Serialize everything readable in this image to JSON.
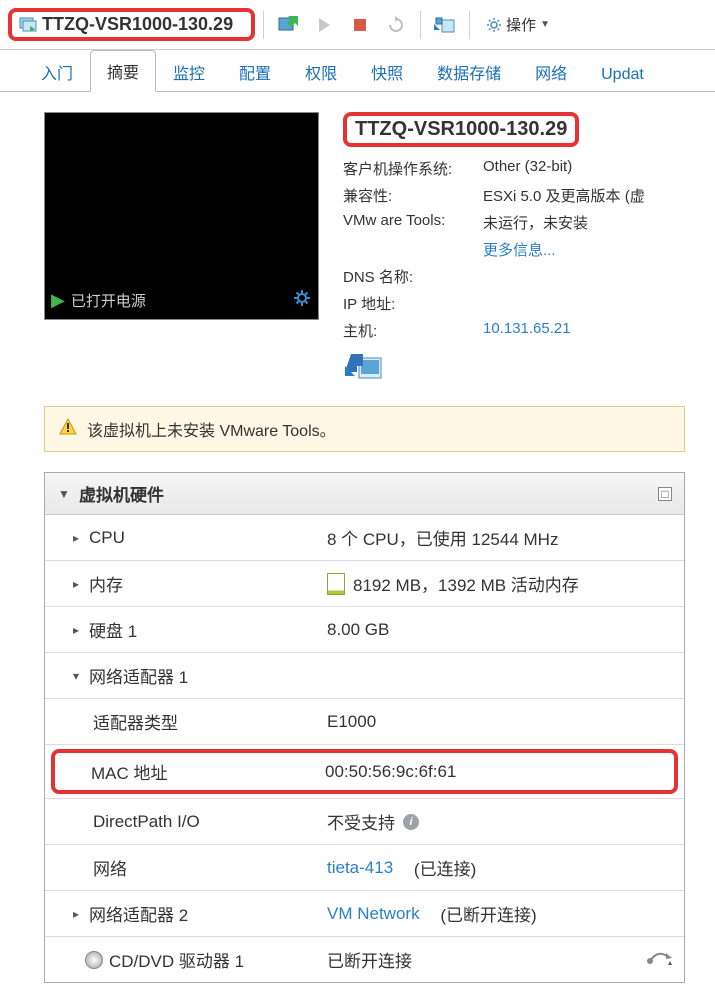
{
  "titlebar": {
    "vm_name": "TTZQ-VSR1000-130.29",
    "actions_label": "操作"
  },
  "tabs": {
    "items": [
      {
        "label": "入门"
      },
      {
        "label": "摘要"
      },
      {
        "label": "监控"
      },
      {
        "label": "配置"
      },
      {
        "label": "权限"
      },
      {
        "label": "快照"
      },
      {
        "label": "数据存储"
      },
      {
        "label": "网络"
      },
      {
        "label": "Updat"
      }
    ],
    "active_index": 1
  },
  "console": {
    "status": "已打开电源"
  },
  "vm": {
    "name": "TTZQ-VSR1000-130.29",
    "guest_os_label": "客户机操作系统:",
    "guest_os": "Other (32-bit)",
    "compat_label": "兼容性:",
    "compat": "ESXi 5.0 及更高版本 (虚",
    "tools_label": "VMw are Tools:",
    "tools": "未运行，未安装",
    "more_info": "更多信息...",
    "dns_label": "DNS 名称:",
    "dns": "",
    "ip_label": "IP 地址:",
    "ip": "",
    "host_label": "主机:",
    "host": "10.131.65.21"
  },
  "warning": {
    "text": "该虚拟机上未安装 VMware Tools。"
  },
  "hardware": {
    "title": "虚拟机硬件",
    "rows": {
      "cpu": {
        "label": "CPU",
        "value": "8 个 CPU，已使用 12544 MHz"
      },
      "memory": {
        "label": "内存",
        "value": "8192 MB，1392 MB 活动内存"
      },
      "disk1": {
        "label": "硬盘 1",
        "value": "8.00 GB"
      },
      "nic1": {
        "label": "网络适配器 1",
        "value": ""
      },
      "adapter_type": {
        "label": "适配器类型",
        "value": "E1000"
      },
      "mac": {
        "label": "MAC 地址",
        "value": "00:50:56:9c:6f:61"
      },
      "directpath": {
        "label": "DirectPath I/O",
        "value": "不受支持"
      },
      "network": {
        "label": "网络",
        "value": "tieta-413",
        "suffix": "(已连接)"
      },
      "nic2": {
        "label": "网络适配器 2",
        "value": "VM Network",
        "suffix": "(已断开连接)"
      },
      "cddvd": {
        "label": "CD/DVD 驱动器 1",
        "value": "已断开连接"
      }
    }
  }
}
